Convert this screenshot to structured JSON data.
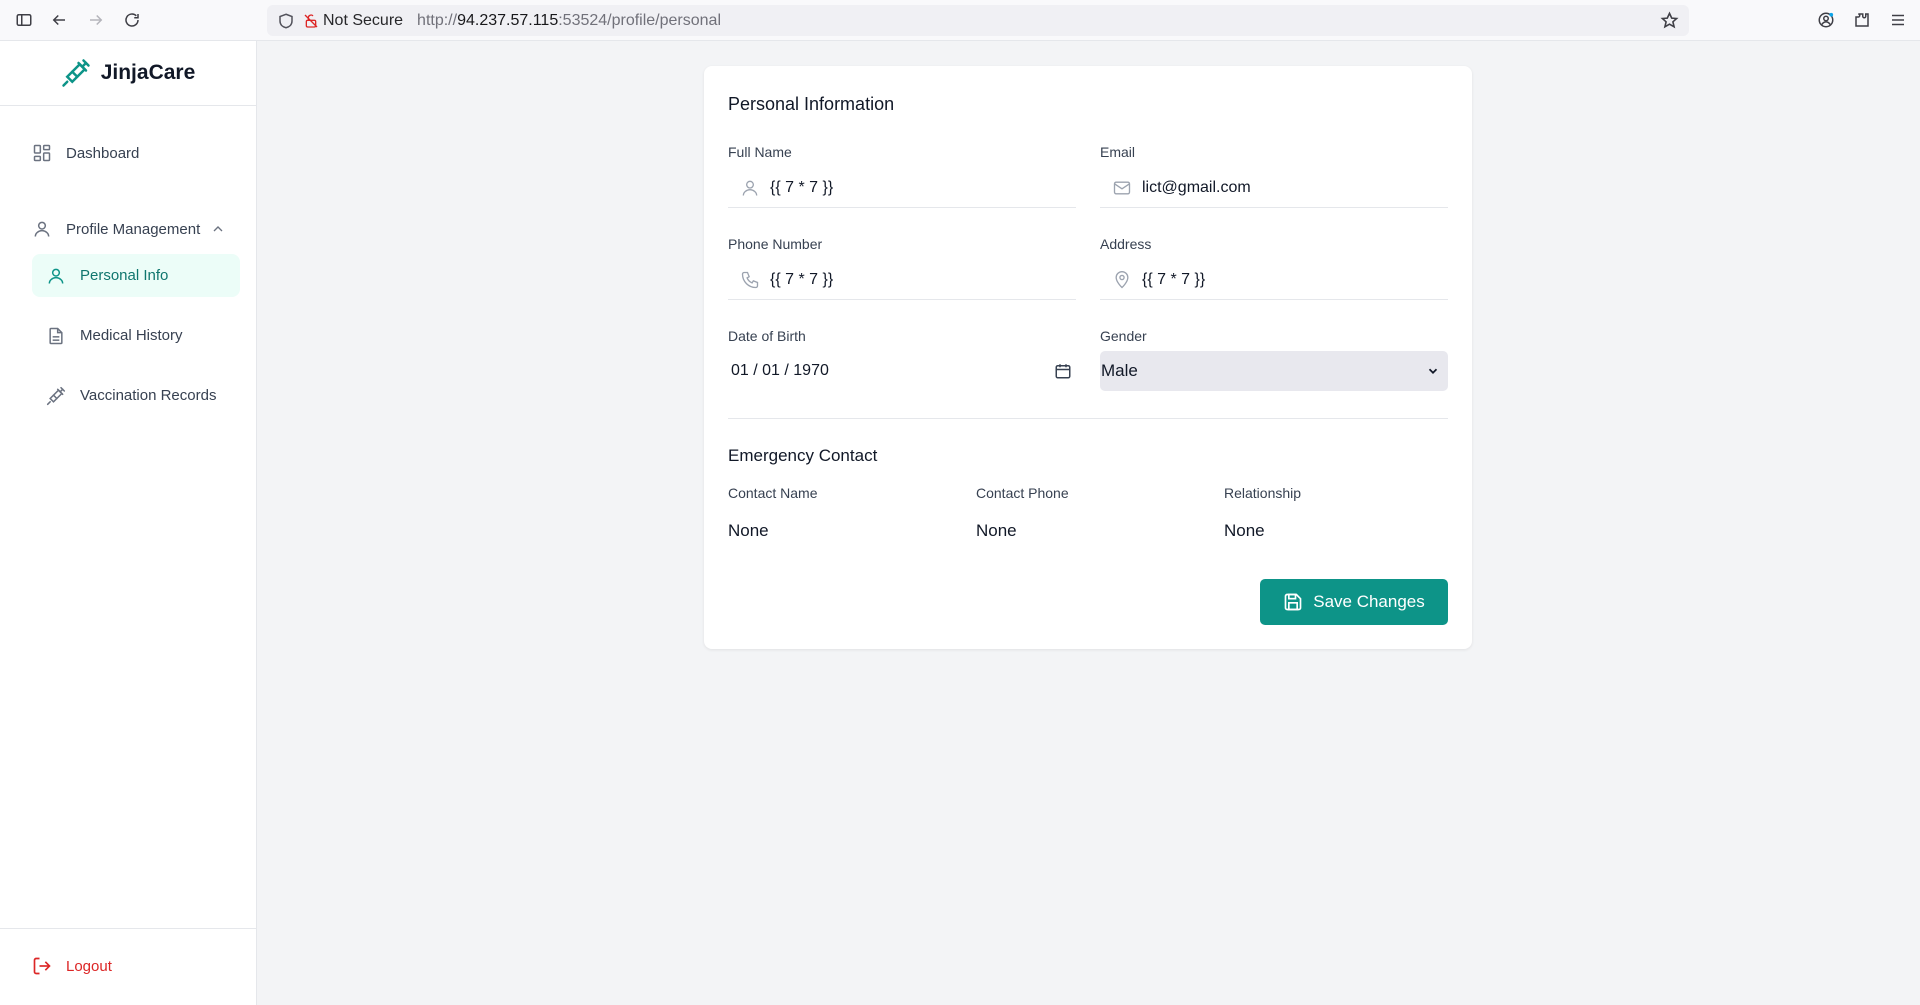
{
  "browser": {
    "security_label": "Not Secure",
    "url_scheme": "http://",
    "url_host": "94.237.57.115",
    "url_rest": ":53524/profile/personal"
  },
  "sidebar": {
    "brand": "JinjaCare",
    "dashboard": "Dashboard",
    "profile_management": "Profile Management",
    "sub_items": [
      "Personal Info",
      "Medical History",
      "Vaccination Records"
    ],
    "logout": "Logout"
  },
  "form": {
    "title": "Personal Information",
    "full_name_label": "Full Name",
    "full_name_value": "{{ 7 * 7 }}",
    "email_label": "Email",
    "email_value": "lict@gmail.com",
    "phone_label": "Phone Number",
    "phone_value": "{{ 7 * 7 }}",
    "address_label": "Address",
    "address_value": "{{ 7 * 7 }}",
    "dob_label": "Date of Birth",
    "dob_value": "01 / 01 / 1970",
    "gender_label": "Gender",
    "gender_value": "Male",
    "emergency_title": "Emergency Contact",
    "contact_name_label": "Contact Name",
    "contact_name_value": "None",
    "contact_phone_label": "Contact Phone",
    "contact_phone_value": "None",
    "relationship_label": "Relationship",
    "relationship_value": "None",
    "save_label": "Save Changes"
  },
  "colors": {
    "accent": "#0d9488",
    "active_bg": "#ecfdf8",
    "logout": "#dc2626"
  }
}
